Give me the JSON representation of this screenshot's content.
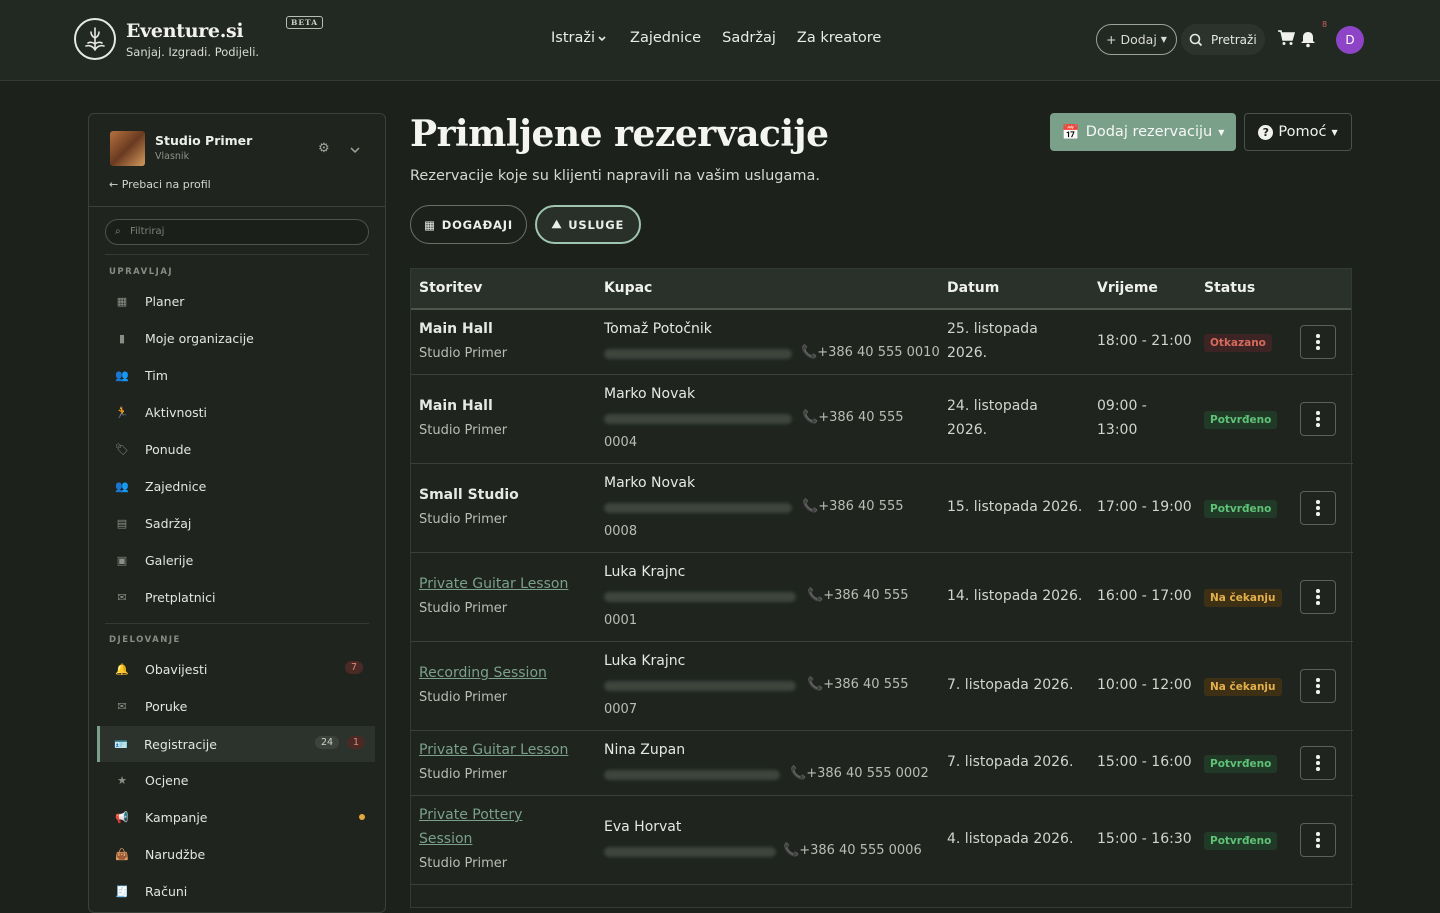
{
  "brand": {
    "name": "Eventure.si",
    "tagline": "Sanjaj. Izgradi. Podijeli.",
    "beta": "BETA"
  },
  "nav": {
    "items": [
      "Istraži",
      "Zajednice",
      "Sadržaj",
      "Za kreatore"
    ]
  },
  "topbar": {
    "add_label": "+ Dodaj",
    "search_label": "Pretraži",
    "notif_count": "8",
    "avatar_initial": "D"
  },
  "sidebar": {
    "profile_name": "Studio Primer",
    "profile_role": "Vlasnik",
    "switch_label": "Prebaci na profil",
    "filter_placeholder": "Filtriraj",
    "section_manage": "UPRAVLJAJ",
    "manage": [
      "Planer",
      "Moje organizacije",
      "Tim",
      "Aktivnosti",
      "Ponude",
      "Zajednice",
      "Sadržaj",
      "Galerije",
      "Pretplatnici"
    ],
    "section_ops": "DJELOVANJE",
    "ops": [
      "Obavijesti",
      "Poruke",
      "Registracije",
      "Ocjene",
      "Kampanje",
      "Narudžbe",
      "Računi"
    ],
    "obavijesti_count": "7",
    "registracije_count": "24",
    "registracije_new": "1"
  },
  "page": {
    "title": "Primljene rezervacije",
    "subtitle": "Rezervacije koje su klijenti napravili na vašim uslugama.",
    "add_booking": "Dodaj rezervaciju",
    "help": "Pomoć",
    "tab_events": "DOGAĐAJI",
    "tab_services": "USLUGE"
  },
  "table": {
    "headers": [
      "Storitev",
      "Kupac",
      "Datum",
      "Vrijeme",
      "Status"
    ],
    "rows": [
      {
        "service": "Main Hall",
        "org": "Studio Primer",
        "buyer": "Tomaž Potočnik",
        "phone": "+386 40 555 0010",
        "date": "25. listopada",
        "date2": "2026.",
        "time": "18:00 - 21:00",
        "time2": "",
        "status": "Otkazano"
      },
      {
        "service": "Main Hall",
        "org": "Studio Primer",
        "buyer": "Marko Novak",
        "phone": "+386 40 555",
        "phone2": "0004",
        "date": "24. listopada",
        "date2": "2026.",
        "time": "09:00 -",
        "time2": "13:00",
        "status": "Potvrđeno"
      },
      {
        "service": "Small Studio",
        "org": "Studio Primer",
        "buyer": "Marko Novak",
        "phone": "+386 40 555",
        "phone2": "0008",
        "date": "15. listopada 2026.",
        "time": "17:00 - 19:00",
        "status": "Potvrđeno"
      },
      {
        "service": "Private Guitar Lesson",
        "org": "Studio Primer",
        "buyer": "Luka Krajnc",
        "phone": "+386 40 555",
        "phone2": "0001",
        "date": "14. listopada 2026.",
        "time": "16:00 - 17:00",
        "status": "Na čekanju"
      },
      {
        "service": "Recording Session",
        "org": "Studio Primer",
        "buyer": "Luka Krajnc",
        "phone": "+386 40 555",
        "phone2": "0007",
        "date": "7. listopada 2026.",
        "time": "10:00 - 12:00",
        "status": "Na čekanju"
      },
      {
        "service": "Private Guitar Lesson",
        "org": "Studio Primer",
        "buyer": "Nina Zupan",
        "phone": "+386 40 555 0002",
        "date": "7. listopada 2026.",
        "time": "15:00 - 16:00",
        "status": "Potvrđeno"
      },
      {
        "service": "Private Pottery",
        "service2": "Session",
        "org": "Studio Primer",
        "buyer": "Eva Horvat",
        "phone": "+386 40 555 0006",
        "date": "4. listopada 2026.",
        "time": "15:00 - 16:30",
        "status": "Potvrđeno"
      }
    ]
  },
  "colors": {
    "accent": "#7aa08a",
    "danger": "#d66a5c",
    "success": "#5fc277",
    "warning": "#e3b04b",
    "avatar": "#8e44c7"
  }
}
